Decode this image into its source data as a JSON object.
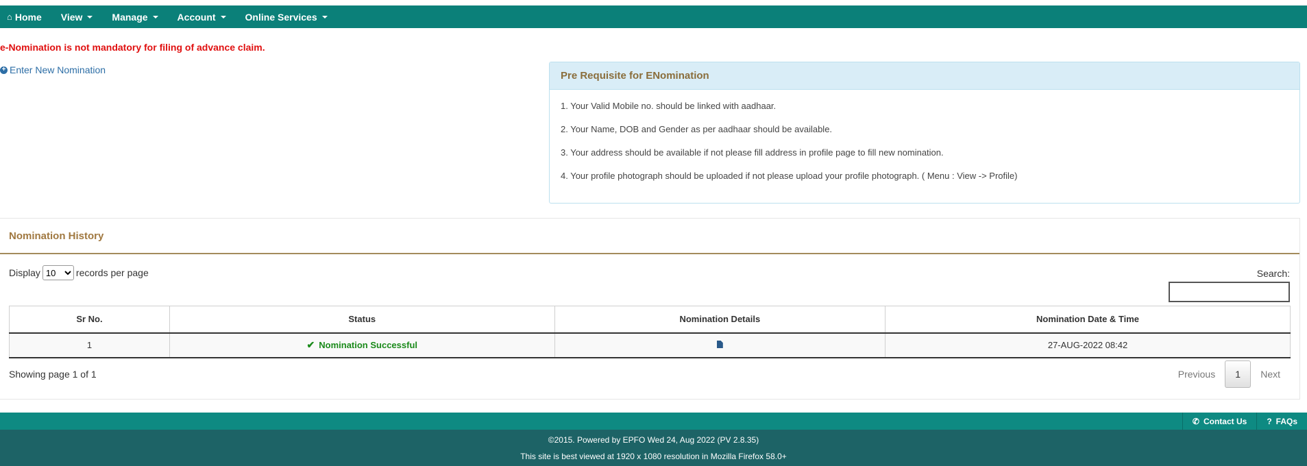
{
  "nav": {
    "items": [
      {
        "label": "Home",
        "icon": "home-icon"
      },
      {
        "label": "View"
      },
      {
        "label": "Manage"
      },
      {
        "label": "Account"
      },
      {
        "label": "Online Services"
      }
    ]
  },
  "notice": "e-Nomination is not mandatory for filing of advance claim.",
  "new_nomination_link": "Enter New Nomination",
  "prereq": {
    "title": "Pre Requisite for ENomination",
    "items": [
      "1. Your Valid Mobile no. should be linked with aadhaar.",
      "2. Your Name, DOB and Gender as per aadhaar should be available.",
      "3. Your address should be available if not please fill address in profile page to fill new nomination.",
      "4. Your profile photograph should be uploaded if not please upload your profile photograph. ( Menu : View -> Profile)"
    ]
  },
  "history": {
    "title": "Nomination History",
    "display_label": "Display",
    "records_label": "records per page",
    "page_size": "10",
    "search_label": "Search:",
    "columns": [
      "Sr No.",
      "Status",
      "Nomination Details",
      "Nomination Date & Time"
    ],
    "rows": [
      {
        "sr": "1",
        "status": "Nomination Successful",
        "details_icon": "document-icon",
        "datetime": "27-AUG-2022 08:42"
      }
    ],
    "info": "Showing page 1 of 1",
    "pager": {
      "previous": "Previous",
      "current": "1",
      "next": "Next"
    }
  },
  "footer": {
    "contact": "Contact Us",
    "faqs": "FAQs",
    "line1": "©2015. Powered by EPFO Wed 24, Aug 2022 (PV 2.8.35)",
    "line2": "This site is best viewed at 1920 x 1080 resolution in Mozilla Firefox 58.0+"
  },
  "colors": {
    "navbar": "#0b8079",
    "notice": "#e01010",
    "status_success": "#1a8a1a",
    "footer_top": "#0e8a82",
    "footer_bottom": "#1d6366"
  }
}
